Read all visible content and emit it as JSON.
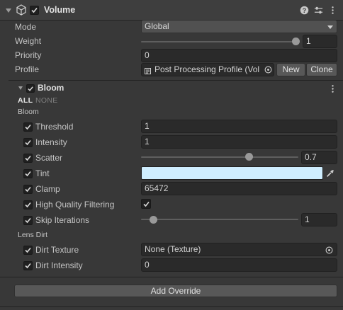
{
  "component": {
    "title": "Volume",
    "enabled": true,
    "icons": [
      "help-icon",
      "preset-icon",
      "menu-dots-icon"
    ]
  },
  "volume": {
    "mode_label": "Mode",
    "mode_value": "Global",
    "weight_label": "Weight",
    "weight_value": "1",
    "weight_fraction": 1.0,
    "priority_label": "Priority",
    "priority_value": "0",
    "profile_label": "Profile",
    "profile_value": "Post Processing Profile (Vol",
    "new_button": "New",
    "clone_button": "Clone"
  },
  "bloom_override": {
    "title": "Bloom",
    "enabled": true,
    "all_label": "ALL",
    "none_label": "NONE",
    "section_bloom": "Bloom",
    "threshold_label": "Threshold",
    "threshold_value": "1",
    "intensity_label": "Intensity",
    "intensity_value": "1",
    "scatter_label": "Scatter",
    "scatter_value": "0.7",
    "scatter_fraction": 0.7,
    "tint_label": "Tint",
    "tint_color": "#cfeeff",
    "clamp_label": "Clamp",
    "clamp_value": "65472",
    "hq_label": "High Quality Filtering",
    "hq_value": true,
    "skip_label": "Skip Iterations",
    "skip_value": "1",
    "skip_fraction": 0.07,
    "section_lens_dirt": "Lens Dirt",
    "dirt_texture_label": "Dirt Texture",
    "dirt_texture_value": "None (Texture)",
    "dirt_intensity_label": "Dirt Intensity",
    "dirt_intensity_value": "0"
  },
  "add_override_button": "Add Override"
}
